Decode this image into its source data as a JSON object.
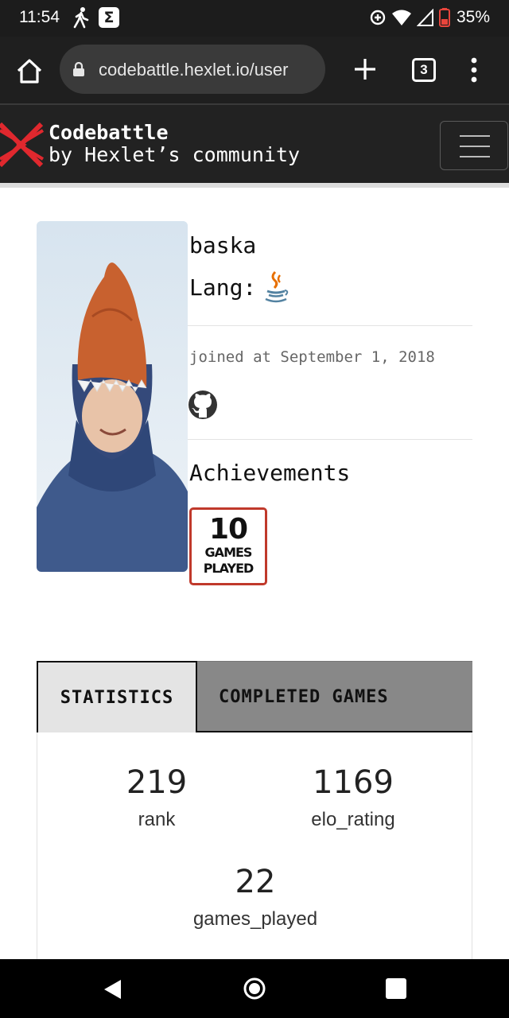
{
  "status_bar": {
    "time": "11:54",
    "sigma_icon": "Σ",
    "battery_percent": "35%",
    "icons": [
      "walking-icon",
      "sigma-icon",
      "data-saver-icon",
      "wifi-icon",
      "signal-icon",
      "battery-icon"
    ]
  },
  "browser": {
    "url": "codebattle.hexlet.io/user",
    "tab_count": "3",
    "icons": [
      "home-icon",
      "lock-icon",
      "plus-icon",
      "more-vert-icon"
    ]
  },
  "site": {
    "brand_name": "Codebattle",
    "brand_sub": "by Hexlet’s community",
    "accent_color": "#e0282e"
  },
  "profile": {
    "username": "baska",
    "lang_label": "Lang:",
    "lang_icon": "java-icon",
    "joined": "joined at September 1, 2018",
    "github_icon": "github-icon"
  },
  "achievements": {
    "title": "Achievements",
    "badge_number": "10",
    "badge_line1": "GAMES",
    "badge_line2": "PLAYED"
  },
  "tabs": [
    {
      "label": "STATISTICS",
      "active": true
    },
    {
      "label": "COMPLETED GAMES",
      "active": false
    }
  ],
  "stats": {
    "rank_value": "219",
    "rank_label": "rank",
    "elo_value": "1169",
    "elo_label": "elo_rating",
    "games_value": "22",
    "games_label": "games_played"
  }
}
